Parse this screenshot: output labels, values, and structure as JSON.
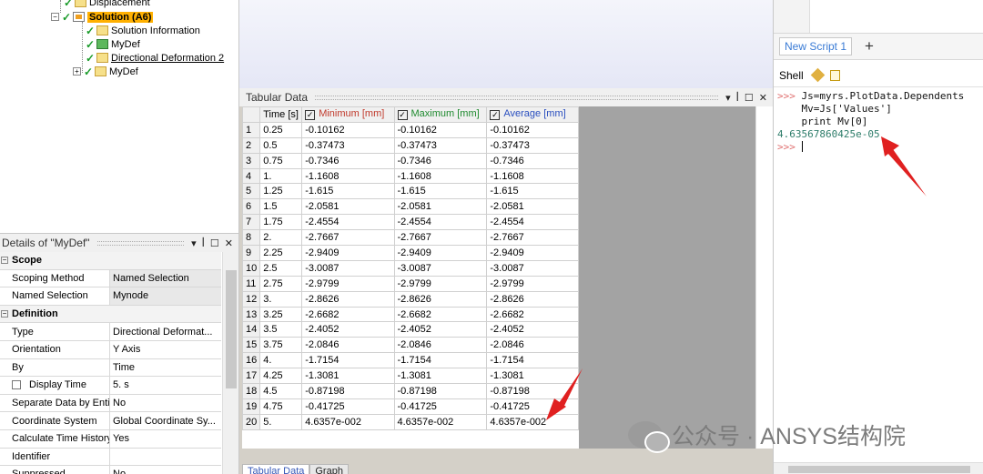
{
  "tree": {
    "items": [
      {
        "label": "Displacement"
      },
      {
        "label": "Solution (A6)"
      },
      {
        "label": "Solution Information"
      },
      {
        "label": "MyDef"
      },
      {
        "label": "Directional Deformation 2"
      },
      {
        "label": "MyDef"
      }
    ]
  },
  "tabular": {
    "title": "Tabular Data",
    "panel_buttons": [
      "▾",
      "ꟾ",
      "☐",
      "✕"
    ],
    "columns": [
      "Time [s]",
      "Minimum [mm]",
      "Maximum [mm]",
      "Average [mm]"
    ],
    "column_colors": [
      "#000000",
      "#c0392b",
      "#1e8a2e",
      "#2a4fbf"
    ],
    "rows": [
      [
        "1",
        "0.25",
        "-0.10162",
        "-0.10162",
        "-0.10162"
      ],
      [
        "2",
        "0.5",
        "-0.37473",
        "-0.37473",
        "-0.37473"
      ],
      [
        "3",
        "0.75",
        "-0.7346",
        "-0.7346",
        "-0.7346"
      ],
      [
        "4",
        "1.",
        "-1.1608",
        "-1.1608",
        "-1.1608"
      ],
      [
        "5",
        "1.25",
        "-1.615",
        "-1.615",
        "-1.615"
      ],
      [
        "6",
        "1.5",
        "-2.0581",
        "-2.0581",
        "-2.0581"
      ],
      [
        "7",
        "1.75",
        "-2.4554",
        "-2.4554",
        "-2.4554"
      ],
      [
        "8",
        "2.",
        "-2.7667",
        "-2.7667",
        "-2.7667"
      ],
      [
        "9",
        "2.25",
        "-2.9409",
        "-2.9409",
        "-2.9409"
      ],
      [
        "10",
        "2.5",
        "-3.0087",
        "-3.0087",
        "-3.0087"
      ],
      [
        "11",
        "2.75",
        "-2.9799",
        "-2.9799",
        "-2.9799"
      ],
      [
        "12",
        "3.",
        "-2.8626",
        "-2.8626",
        "-2.8626"
      ],
      [
        "13",
        "3.25",
        "-2.6682",
        "-2.6682",
        "-2.6682"
      ],
      [
        "14",
        "3.5",
        "-2.4052",
        "-2.4052",
        "-2.4052"
      ],
      [
        "15",
        "3.75",
        "-2.0846",
        "-2.0846",
        "-2.0846"
      ],
      [
        "16",
        "4.",
        "-1.7154",
        "-1.7154",
        "-1.7154"
      ],
      [
        "17",
        "4.25",
        "-1.3081",
        "-1.3081",
        "-1.3081"
      ],
      [
        "18",
        "4.5",
        "-0.87198",
        "-0.87198",
        "-0.87198"
      ],
      [
        "19",
        "4.75",
        "-0.41725",
        "-0.41725",
        "-0.41725"
      ],
      [
        "20",
        "5.",
        "4.6357e-002",
        "4.6357e-002",
        "4.6357e-002"
      ]
    ],
    "bottom_tabs": [
      "Tabular Data",
      "Graph"
    ]
  },
  "details": {
    "title": "Details of \"MyDef\"",
    "panel_buttons": [
      "▾",
      "ꟾ",
      "☐",
      "✕"
    ],
    "rows": [
      {
        "group": true,
        "key": "Scope",
        "value": ""
      },
      {
        "key": "Scoping Method",
        "value": "Named Selection",
        "shaded": true
      },
      {
        "key": "Named Selection",
        "value": "Mynode",
        "shaded": true
      },
      {
        "group": true,
        "key": "Definition",
        "value": ""
      },
      {
        "key": "Type",
        "value": "Directional Deformat..."
      },
      {
        "key": "Orientation",
        "value": "Y Axis"
      },
      {
        "key": "By",
        "value": "Time"
      },
      {
        "key": "Display Time",
        "value": "5. s",
        "checkbox": true
      },
      {
        "key": "Separate Data by Entity",
        "value": "No"
      },
      {
        "key": "Coordinate System",
        "value": "Global Coordinate Sy..."
      },
      {
        "key": "Calculate Time History",
        "value": "Yes"
      },
      {
        "key": "Identifier",
        "value": ""
      },
      {
        "key": "Suppressed",
        "value": "No"
      }
    ]
  },
  "script": {
    "tab_label": "New Script 1",
    "add_label": "+"
  },
  "shell": {
    "title": "Shell",
    "lines": [
      {
        "prompt": ">>> ",
        "text": "Js=myrs.PlotData.Dependents",
        "kind": "code"
      },
      {
        "prompt": "    ",
        "text": "Mv=Js['Values']",
        "kind": "code"
      },
      {
        "prompt": "    ",
        "text": "print Mv[0]",
        "kind": "code"
      },
      {
        "prompt": "",
        "text": "4.63567860425e-05",
        "kind": "out"
      },
      {
        "prompt": ">>> ",
        "text": "",
        "kind": "cursor"
      }
    ]
  },
  "watermark": {
    "text": "公众号 · ANSYS结构院"
  },
  "colors": {
    "accent_arrow": "#e02020",
    "solution_highlight": "#ffb000",
    "check_green": "#1a9b2a"
  }
}
